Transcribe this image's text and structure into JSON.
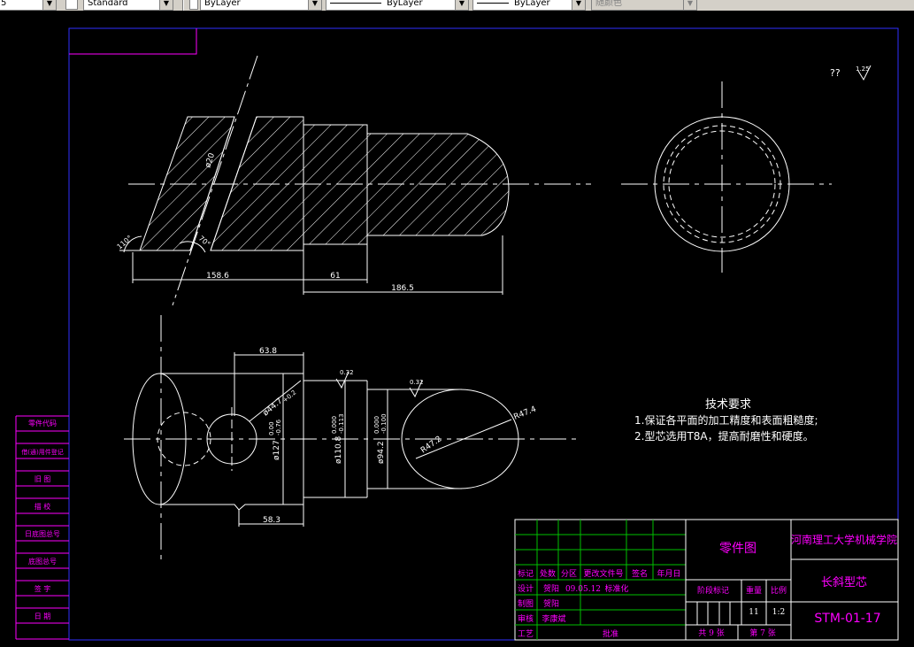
{
  "toolbar": {
    "combo1_value": "5",
    "textstyle_value": "Standard",
    "layer_value": "ByLayer",
    "linetype_value": "ByLayer",
    "lineweight_value": "ByLayer",
    "plotstyle_value": "随颜色"
  },
  "drawing": {
    "dims": {
      "d158": "158.6",
      "d61": "61",
      "d186": "186.5",
      "d638": "63.8",
      "d583": "58.3",
      "r472": "R47.2",
      "r474": "R47.4",
      "phi44": "ø44.7",
      "tol44": "+0.2",
      "phi127": "ø127",
      "tol127a": "0.00",
      "tol127b": "-0.76",
      "phi110": "ø110.8",
      "tol110a": "0.000",
      "tol110b": "-0.113",
      "phi94": "ø94.2",
      "tol94a": "0.000",
      "tol94b": "-0.100",
      "phi20": "ø20",
      "ang110": "110°",
      "ang70": "70°",
      "rough1": "0.32",
      "rough2": "0.32",
      "rough_top": "1.25",
      "qq": "??"
    },
    "tech_req": {
      "title": "技术要求",
      "line1": "1.保证各平面的加工精度和表面粗糙度;",
      "line2": "2.型芯选用T8A，提高耐磨性和硬度。"
    },
    "left_strip": [
      "零件代码",
      "借(通)用件登记",
      "旧 图",
      "描 校",
      "日底图总号",
      "底图总号",
      "签 字",
      "日 期"
    ],
    "title_block": {
      "h_biaoji": "标记",
      "h_chushu": "处数",
      "h_fenqu": "分区",
      "h_gengai": "更改文件号",
      "h_qianming": "签名",
      "h_nianyueri": "年月日",
      "r_sheji": "设计",
      "r_sheji_name": "贺阳",
      "r_sheji_date": "09.05.12",
      "r_biaozhunhua": "标准化",
      "r_zhitu": "制图",
      "r_zhitu_name": "贺阳",
      "r_shenhe": "审核",
      "r_shenhe_name": "李康斌",
      "r_gongyi": "工艺",
      "r_pizhun": "批准",
      "part_title": "零件图",
      "school": "河南理工大学机械学院",
      "part_name": "长斜型芯",
      "jieduan": "阶段标记",
      "shuliang": "重量",
      "bili": "比例",
      "weight_val": "11",
      "scale_val": "1:2",
      "total_sheets": "共 9 张",
      "sheet_no": "第 7 张",
      "drawing_no": "STM-01-17"
    }
  }
}
